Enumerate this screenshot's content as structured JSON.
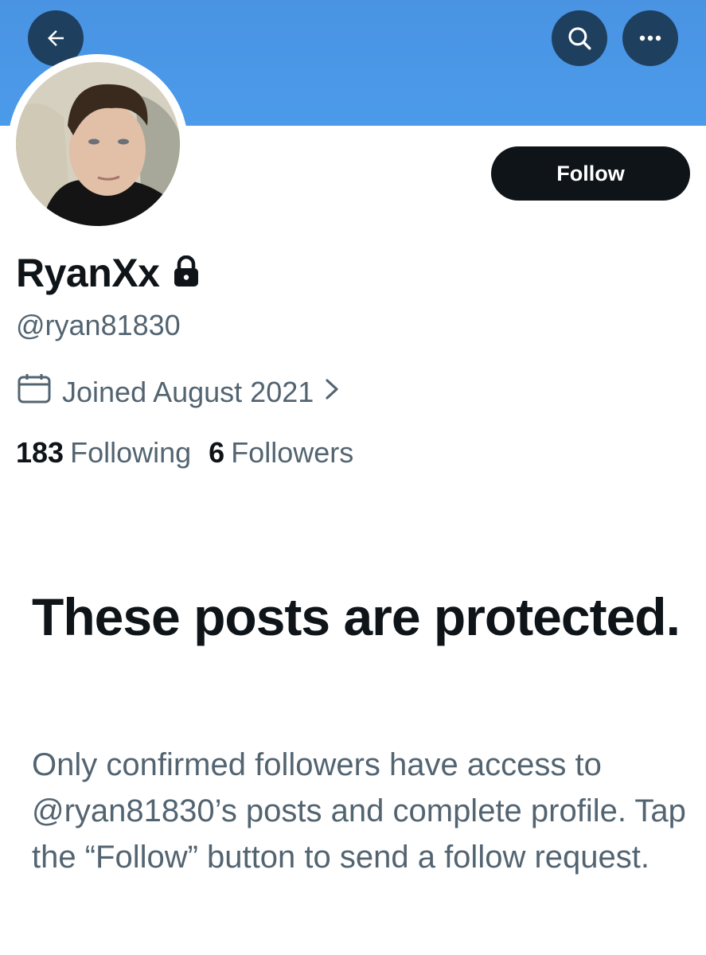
{
  "header": {
    "back_icon": "arrow-left-icon",
    "search_icon": "search-icon",
    "more_icon": "ellipsis-icon",
    "banner_color": "#4a93e3"
  },
  "profile": {
    "display_name": "RyanXx",
    "lock_icon": "lock-icon",
    "handle": "@ryan81830",
    "joined_text": "Joined August 2021",
    "joined_icon": "calendar-icon",
    "joined_chevron": "chevron-right-icon",
    "following_count": "183",
    "following_label": "Following",
    "followers_count": "6",
    "followers_label": "Followers"
  },
  "actions": {
    "follow_label": "Follow"
  },
  "protected": {
    "title": "These posts are protected.",
    "description": "Only confirmed followers have access to @ryan81830’s posts and complete profile. Tap the “Follow” button to send a follow request."
  },
  "colors": {
    "text_primary": "#0f1419",
    "text_secondary": "#536471",
    "button_dark": "#0f1419",
    "header_button": "#1f3f5f"
  }
}
